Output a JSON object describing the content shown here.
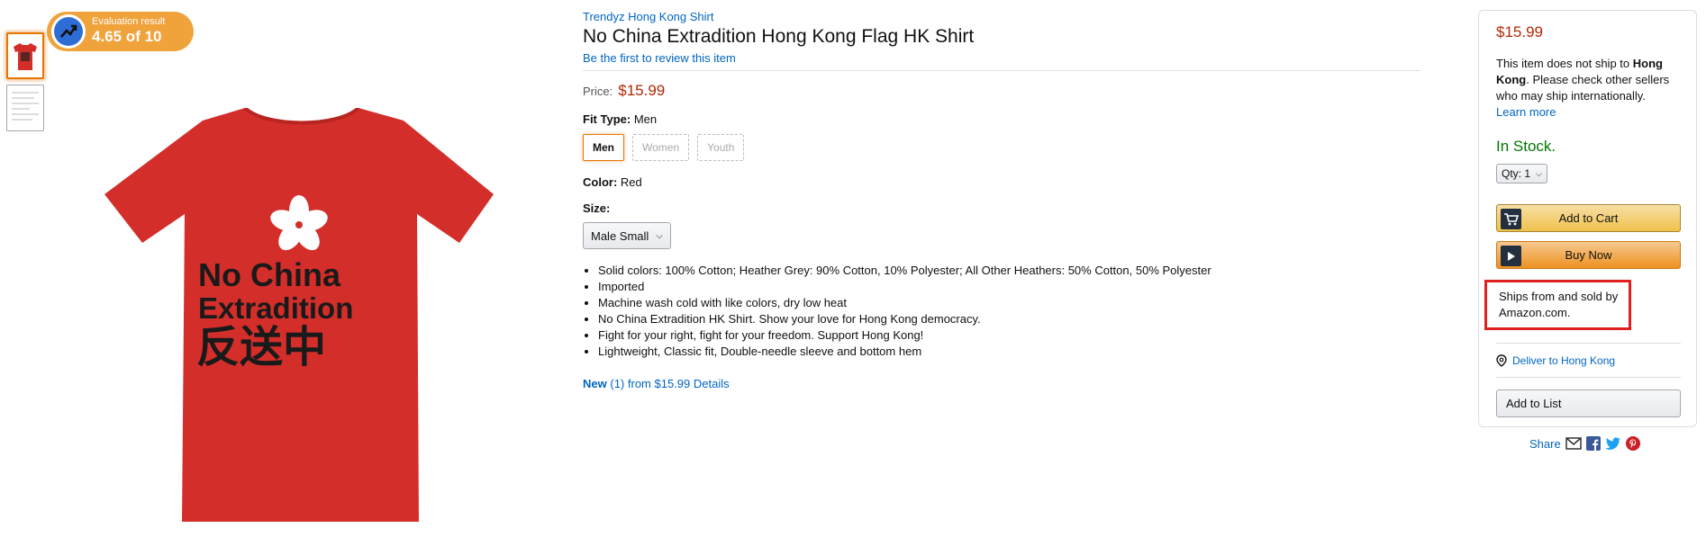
{
  "evaluation": {
    "title": "Evaluation result",
    "score": "4.65 of 10"
  },
  "product": {
    "brand": "Trendyz Hong Kong Shirt",
    "title": "No China Extradition Hong Kong Flag HK Shirt",
    "review_link": "Be the first to review this item",
    "price_label": "Price:",
    "price": "$15.99",
    "fit_type_label": "Fit Type:",
    "fit_type_value": "Men",
    "fit_options": [
      "Men",
      "Women",
      "Youth"
    ],
    "color_label": "Color:",
    "color_value": "Red",
    "size_label": "Size:",
    "size_selected": "Male Small",
    "bullets": [
      "Solid colors: 100% Cotton; Heather Grey: 90% Cotton, 10% Polyester; All Other Heathers: 50% Cotton, 50% Polyester",
      "Imported",
      "Machine wash cold with like colors, dry low heat",
      "No China Extradition HK Shirt. Show your love for Hong Kong democracy.",
      "Fight for your right, fight for your freedom. Support Hong Kong!",
      "Lightweight, Classic fit, Double-needle sleeve and bottom hem"
    ],
    "offers": {
      "new_label": "New",
      "count": "(1)",
      "from": "from $15.99",
      "details": "Details"
    },
    "shirt_text": {
      "line1": "No China",
      "line2": "Extradition",
      "line3": "反送中"
    }
  },
  "buybox": {
    "price": "$15.99",
    "ship_pre": "This item does not ship to ",
    "ship_place": "Hong Kong",
    "ship_post": ". Please check other sellers who may ship internationally.",
    "learn_more": "Learn more",
    "stock": "In Stock.",
    "qty": "Qty: 1",
    "add_to_cart": "Add to Cart",
    "buy_now": "Buy Now",
    "ships_from": "Ships from and sold by Amazon.com.",
    "deliver": "Deliver to Hong Kong",
    "add_to_list": "Add to List",
    "share": "Share"
  },
  "colors": {
    "link": "#0066c0",
    "price": "#b12704",
    "stock": "#007600",
    "shirt": "#d42e2a",
    "highlight": "#e01f1f",
    "badge": "#f0a23b"
  }
}
